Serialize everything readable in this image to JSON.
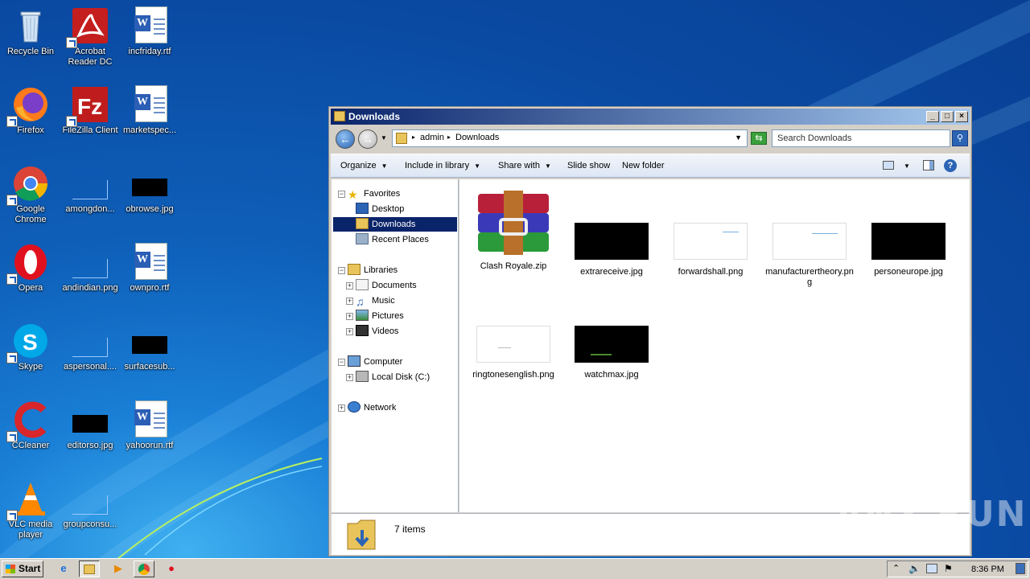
{
  "desktop": {
    "icons": [
      {
        "label": "Recycle Bin"
      },
      {
        "label": "Acrobat Reader DC"
      },
      {
        "label": "incfriday.rtf"
      },
      {
        "label": "Firefox"
      },
      {
        "label": "FileZilla Client"
      },
      {
        "label": "marketspec..."
      },
      {
        "label": "Google Chrome"
      },
      {
        "label": "amongdon..."
      },
      {
        "label": "obrowse.jpg"
      },
      {
        "label": "Opera"
      },
      {
        "label": "andindian.png"
      },
      {
        "label": "ownpro.rtf"
      },
      {
        "label": "Skype"
      },
      {
        "label": "aspersonal...."
      },
      {
        "label": "surfacesub..."
      },
      {
        "label": "CCleaner"
      },
      {
        "label": "editorso.jpg"
      },
      {
        "label": "yahoorun.rtf"
      },
      {
        "label": "VLC media player"
      },
      {
        "label": "groupconsu..."
      }
    ]
  },
  "window": {
    "title": "Downloads",
    "controls": {
      "minimize": "_",
      "maximize": "□",
      "close": "×"
    },
    "address": {
      "crumbs": [
        "admin",
        "Downloads"
      ]
    },
    "search": {
      "placeholder": "Search Downloads"
    },
    "toolbar": {
      "organize": "Organize",
      "include_in_library": "Include in library",
      "share_with": "Share with",
      "slide_show": "Slide show",
      "new_folder": "New folder"
    },
    "nav": {
      "favorites": "Favorites",
      "desktop": "Desktop",
      "downloads": "Downloads",
      "recent_places": "Recent Places",
      "libraries": "Libraries",
      "documents": "Documents",
      "music": "Music",
      "pictures": "Pictures",
      "videos": "Videos",
      "computer": "Computer",
      "local_disk": "Local Disk (C:)",
      "network": "Network"
    },
    "files": [
      {
        "name": "Clash Royale.zip"
      },
      {
        "name": "extrareceive.jpg"
      },
      {
        "name": "forwardshall.png"
      },
      {
        "name": "manufacturertheory.png"
      },
      {
        "name": "personeurope.jpg"
      },
      {
        "name": "ringtonesenglish.png"
      },
      {
        "name": "watchmax.jpg"
      }
    ],
    "status": {
      "count": "7 items"
    }
  },
  "taskbar": {
    "start": "Start",
    "clock": "8:36 PM"
  },
  "watermark": "ANY RUN",
  "colors": {
    "selection": "#0a246a",
    "desktop": "#0e5fb8",
    "titlebar": "#0a246a"
  }
}
